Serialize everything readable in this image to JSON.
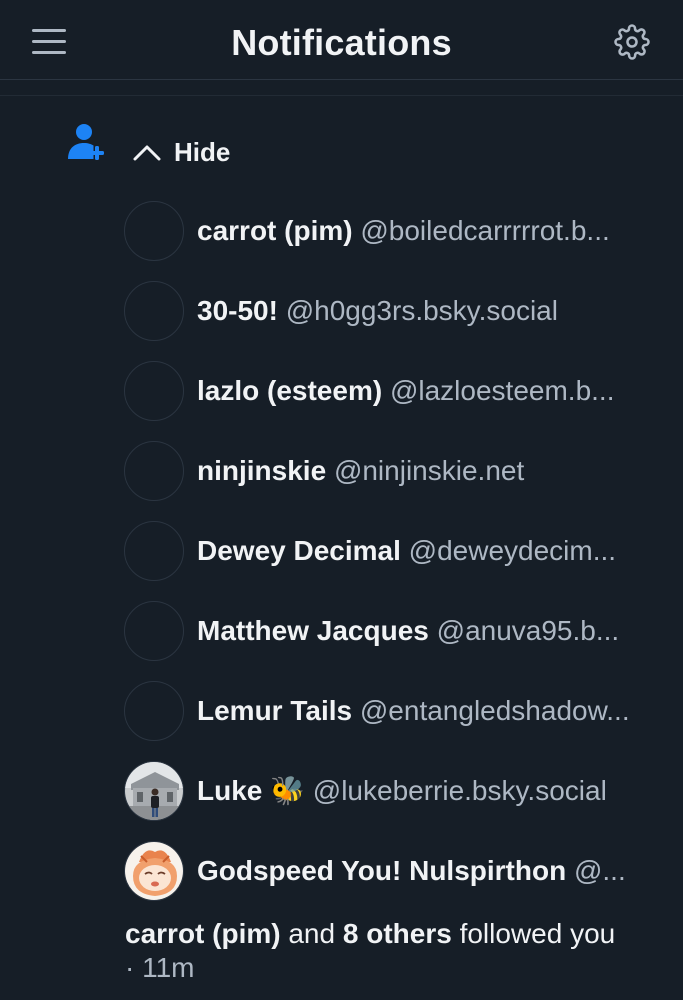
{
  "header": {
    "title": "Notifications",
    "menu_icon": "hamburger-menu-icon",
    "settings_icon": "gear-icon"
  },
  "notification": {
    "type_icon": "person-plus-icon",
    "hide_label": "Hide",
    "hide_icon": "chevron-up-icon",
    "users": [
      {
        "name": "carrot (pim)",
        "handle": "@boiledcarrrrrot.b..."
      },
      {
        "name": "30-50!",
        "handle": "@h0gg3rs.bsky.social"
      },
      {
        "name": "lazlo (esteem)",
        "handle": "@lazloesteem.b..."
      },
      {
        "name": "ninjinskie",
        "handle": "@ninjinskie.net"
      },
      {
        "name": "Dewey Decimal",
        "handle": "@deweydecim..."
      },
      {
        "name": "Matthew Jacques",
        "handle": "@anuva95.b..."
      },
      {
        "name": "Lemur Tails",
        "handle": "@entangledshadow..."
      },
      {
        "name": "Luke 🐝",
        "handle": "@lukeberrie.bsky.social"
      },
      {
        "name": "Godspeed You! Nulspirthon",
        "handle": "@..."
      }
    ],
    "summary": {
      "first_name": "carrot (pim)",
      "and_text": "and",
      "others_text": "8 others",
      "action_text": "followed you",
      "time": "· 11m"
    }
  },
  "colors": {
    "background": "#161e27",
    "accent": "#1d83f5",
    "text_primary": "#f1f3f5",
    "text_secondary": "#aeb8c4"
  }
}
